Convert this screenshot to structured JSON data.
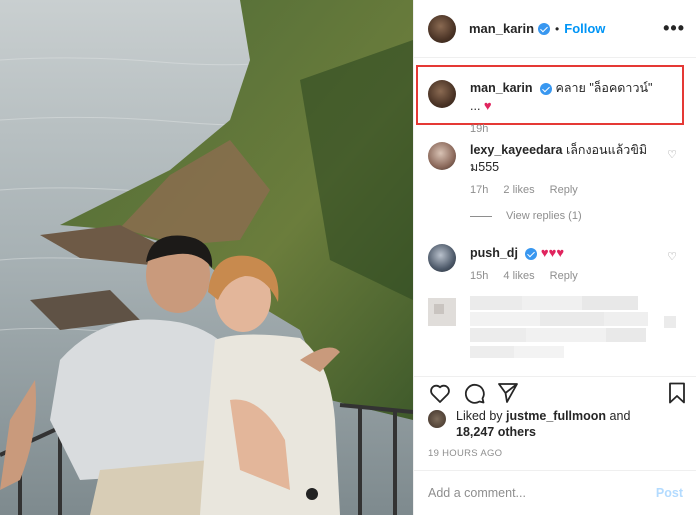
{
  "header": {
    "username": "man_karin",
    "dot": "•",
    "follow_label": "Follow",
    "more_label": "•••"
  },
  "caption": {
    "username": "man_karin",
    "text": "คลาย \"ล็อคดาวน์\" ...",
    "heart": "♥",
    "time": "19h"
  },
  "comments": [
    {
      "username": "lexy_kayeedara",
      "text": "เล็กงอนแล้วขิมิม555",
      "time": "17h",
      "likes": "2 likes",
      "reply_label": "Reply",
      "heart": "♡"
    },
    {
      "username": "push_dj",
      "text": "♥♥♥",
      "time": "15h",
      "likes": "4 likes",
      "reply_label": "Reply",
      "heart": "♡"
    }
  ],
  "view_replies": "View replies (1)",
  "likes": {
    "prefix": "Liked by",
    "user": "justme_fullmoon",
    "and": "and",
    "count": "18,247 others"
  },
  "time_ago": "19 HOURS AGO",
  "add_comment": {
    "placeholder": "Add a comment...",
    "post_label": "Post"
  }
}
